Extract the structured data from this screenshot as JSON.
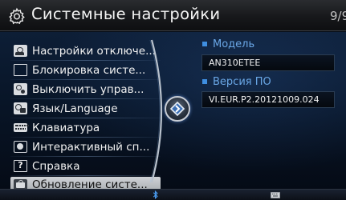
{
  "header": {
    "title": "Системные настройки",
    "page_indicator": "9/9"
  },
  "menu": {
    "items": [
      {
        "label": "Настройки отключе...",
        "icon": "power-off-settings-icon",
        "selected": false
      },
      {
        "label": "Блокировка систе...",
        "icon": "checkbox-icon",
        "selected": false
      },
      {
        "label": "Выключить управ...",
        "icon": "steering-control-icon",
        "selected": false
      },
      {
        "label": "Язык/Language",
        "icon": "language-globe-icon",
        "selected": false
      },
      {
        "label": "Клавиатура",
        "icon": "keyboard-icon",
        "selected": false
      },
      {
        "label": "Интерактивный сп...",
        "icon": "interactive-guide-icon",
        "selected": false
      },
      {
        "label": "Справка",
        "icon": "help-icon",
        "selected": false
      },
      {
        "label": "Обновление систе...",
        "icon": "system-update-icon",
        "selected": true
      }
    ]
  },
  "info": {
    "model_label": "Модель",
    "model_value": "AN310ETEE",
    "software_label": "Версия ПО",
    "software_value": "VI.EUR.P2.20121009.024"
  },
  "colors": {
    "accent_blue": "#3f8ee0",
    "label_blue": "#6aa7e6",
    "selected_bg": "#bfc3c8"
  },
  "status_bar": {
    "icons": [
      "bluetooth-icon",
      "keyboard-status-icon"
    ]
  }
}
